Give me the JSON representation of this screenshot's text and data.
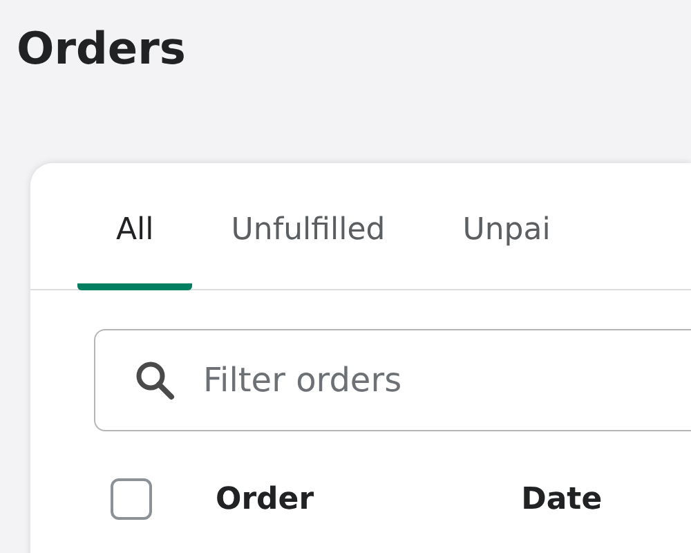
{
  "page": {
    "title": "Orders"
  },
  "tabs": [
    {
      "label": "All",
      "selected": true
    },
    {
      "label": "Unfulfilled",
      "selected": false
    },
    {
      "label": "Unpai",
      "selected": false
    }
  ],
  "search": {
    "placeholder": "Filter orders"
  },
  "table": {
    "select_all": {
      "checked": false
    },
    "columns": [
      "Order",
      "Date"
    ]
  }
}
